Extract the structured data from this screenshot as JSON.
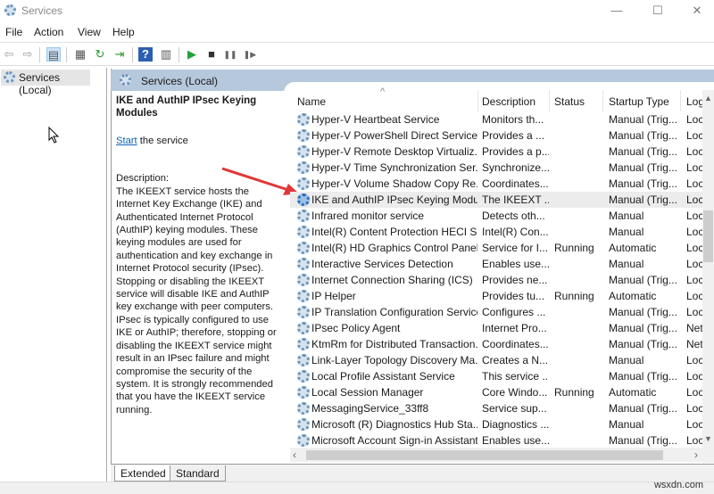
{
  "window": {
    "title": "Services",
    "minimize": "—",
    "maximize": "☐",
    "close": "✕"
  },
  "menu": [
    "File",
    "Action",
    "View",
    "Help"
  ],
  "toolbar": {
    "back": "⇦",
    "forward": "⇨",
    "show_hide": "▤",
    "properties": "▦",
    "refresh": "↻",
    "export": "⇥",
    "help": "?",
    "console": "▥",
    "start": "▶",
    "stop": "■",
    "pause": "❚❚",
    "resume": "❚▶"
  },
  "tree": {
    "item": "Services (Local)"
  },
  "panel": {
    "header": "Services (Local)"
  },
  "details": {
    "title": "IKE and AuthIP IPsec Keying Modules",
    "start_link": "Start",
    "start_suffix": " the service",
    "description_label": "Description:",
    "description": "The IKEEXT service hosts the Internet Key Exchange (IKE) and Authenticated Internet Protocol (AuthIP) keying modules. These keying modules are used for authentication and key exchange in Internet Protocol security (IPsec). Stopping or disabling the IKEEXT service will disable IKE and AuthIP key exchange with peer computers. IPsec is typically configured to use IKE or AuthIP; therefore, stopping or disabling the IKEEXT service might result in an IPsec failure and might compromise the security of the system. It is strongly recommended that you have the IKEEXT service running."
  },
  "columns": {
    "name": "Name",
    "description": "Description",
    "status": "Status",
    "startup": "Startup Type",
    "logon": "Log"
  },
  "services": [
    {
      "name": "Hyper-V Heartbeat Service",
      "desc": "Monitors th...",
      "status": "",
      "startup": "Manual (Trig...",
      "logon": "Loc"
    },
    {
      "name": "Hyper-V PowerShell Direct Service",
      "desc": "Provides a ...",
      "status": "",
      "startup": "Manual (Trig...",
      "logon": "Loc"
    },
    {
      "name": "Hyper-V Remote Desktop Virtualiz...",
      "desc": "Provides a p...",
      "status": "",
      "startup": "Manual (Trig...",
      "logon": "Loc"
    },
    {
      "name": "Hyper-V Time Synchronization Ser...",
      "desc": "Synchronize...",
      "status": "",
      "startup": "Manual (Trig...",
      "logon": "Loc"
    },
    {
      "name": "Hyper-V Volume Shadow Copy Re...",
      "desc": "Coordinates...",
      "status": "",
      "startup": "Manual (Trig...",
      "logon": "Loc"
    },
    {
      "name": "IKE and AuthIP IPsec Keying Modu...",
      "desc": "The IKEEXT ...",
      "status": "",
      "startup": "Manual (Trig...",
      "logon": "Loc"
    },
    {
      "name": "Infrared monitor service",
      "desc": "Detects oth...",
      "status": "",
      "startup": "Manual",
      "logon": "Loc"
    },
    {
      "name": "Intel(R) Content Protection HECI S...",
      "desc": "Intel(R) Con...",
      "status": "",
      "startup": "Manual",
      "logon": "Loc"
    },
    {
      "name": "Intel(R) HD Graphics Control Panel...",
      "desc": "Service for I...",
      "status": "Running",
      "startup": "Automatic",
      "logon": "Loc"
    },
    {
      "name": "Interactive Services Detection",
      "desc": "Enables use...",
      "status": "",
      "startup": "Manual",
      "logon": "Loc"
    },
    {
      "name": "Internet Connection Sharing (ICS)",
      "desc": "Provides ne...",
      "status": "",
      "startup": "Manual (Trig...",
      "logon": "Loc"
    },
    {
      "name": "IP Helper",
      "desc": "Provides tu...",
      "status": "Running",
      "startup": "Automatic",
      "logon": "Loc"
    },
    {
      "name": "IP Translation Configuration Service",
      "desc": "Configures ...",
      "status": "",
      "startup": "Manual (Trig...",
      "logon": "Loc"
    },
    {
      "name": "IPsec Policy Agent",
      "desc": "Internet Pro...",
      "status": "",
      "startup": "Manual (Trig...",
      "logon": "Net"
    },
    {
      "name": "KtmRm for Distributed Transaction...",
      "desc": "Coordinates...",
      "status": "",
      "startup": "Manual (Trig...",
      "logon": "Net"
    },
    {
      "name": "Link-Layer Topology Discovery Ma...",
      "desc": "Creates a N...",
      "status": "",
      "startup": "Manual",
      "logon": "Loc"
    },
    {
      "name": "Local Profile Assistant Service",
      "desc": "This service ...",
      "status": "",
      "startup": "Manual (Trig...",
      "logon": "Loc"
    },
    {
      "name": "Local Session Manager",
      "desc": "Core Windo...",
      "status": "Running",
      "startup": "Automatic",
      "logon": "Loc"
    },
    {
      "name": "MessagingService_33ff8",
      "desc": "Service sup...",
      "status": "",
      "startup": "Manual (Trig...",
      "logon": "Loc"
    },
    {
      "name": "Microsoft (R) Diagnostics Hub Sta...",
      "desc": "Diagnostics ...",
      "status": "",
      "startup": "Manual",
      "logon": "Loc"
    },
    {
      "name": "Microsoft Account Sign-in Assistant",
      "desc": "Enables use...",
      "status": "",
      "startup": "Manual (Trig...",
      "logon": "Loc"
    }
  ],
  "selected_index": 5,
  "tabs": [
    "Extended",
    "Standard"
  ],
  "watermark": "wsxdn.com",
  "colors": {
    "header_band": "#b6c8dc",
    "link": "#0b63b6",
    "arrow": "#e0383a"
  }
}
